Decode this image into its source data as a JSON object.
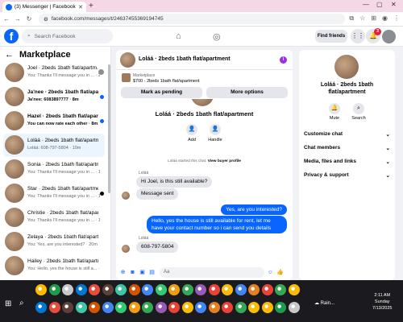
{
  "browser": {
    "tab_title": "(3) Messenger | Facebook",
    "new_tab_glyph": "+",
    "url": "facebook.com/messages/t/24637455369194745"
  },
  "header": {
    "search_placeholder": "Search Facebook",
    "find_friends": "Find friends",
    "notification_count": "3"
  },
  "marketplace": {
    "title": "Marketplace",
    "conversations": [
      {
        "name": "Joel · 2beds 1bath flat/apartm...",
        "preview": "You: Thanks I'll message you in ... · 2m",
        "unread": false,
        "mark": "mini"
      },
      {
        "name": "Ja'nee · 2beds 1bath flat/apart...",
        "preview": "Ja'nee: 6083897777 · 8m",
        "unread": true,
        "mark": "dot"
      },
      {
        "name": "Hazel · 2beds 1bath flat/apartm...",
        "preview": "You can now rate each other · 8m",
        "unread": true,
        "mark": "dot"
      },
      {
        "name": "Loláá · 2beds 1bath flat/apartm...",
        "preview": "Loláá: 608-797-5804 · 10m",
        "unread": false,
        "mark": "none"
      },
      {
        "name": "Sonia · 2beds 1bath flat/apartm...",
        "preview": "You: Thanks I'll message you in ... · 19m",
        "unread": false,
        "mark": "none"
      },
      {
        "name": "Star · 2beds 1bath flat/apartme...",
        "preview": "You: Thanks I'll message you in ... · 19m",
        "unread": false,
        "mark": "black"
      },
      {
        "name": "Christie · 2beds 1bath flat/apar...",
        "preview": "You: Thanks I'll message you in ... · 19m",
        "unread": false,
        "mark": "none"
      },
      {
        "name": "Zelaya · 2beds 1bath flat/apartm...",
        "preview": "You: Yes, are you interested? · 20m",
        "unread": false,
        "mark": "none"
      },
      {
        "name": "Hailey · 2beds 1bath flat/apartm...",
        "preview": "You: Hello, yes the house is still a... · 20m",
        "unread": false,
        "mark": "none"
      },
      {
        "name": "Dawn · 2beds 1bath flat/apartm...",
        "preview": "You: Yes, are you interested? · 20m",
        "unread": false,
        "mark": "none"
      }
    ]
  },
  "chat": {
    "title": "Loláá · 2beds 1bath flat/apartment",
    "listing_label": "Marketplace",
    "listing_detail": "$700 · 2beds 1bath flat/apartment",
    "mark_pending": "Mark as pending",
    "more_options": "More options",
    "profile_name": "Loláá · 2beds 1bath flat/apartment",
    "add_label": "Add",
    "handle_label": "Handle",
    "system_message": "Loláá started this chat.",
    "view_profile": "View buyer profile",
    "sender_name": "Loláá",
    "msg1": "Hi Joel, is this still available?",
    "msg2": "Message sent",
    "msg3": "Yes, are you interested?",
    "msg4": "Hello, yes the house is still available for rent, let me have your contact number so i can send you details",
    "sender_name2": "Loláá",
    "msg5": "608-797-5804",
    "input_placeholder": "Aa"
  },
  "details": {
    "name_line1": "Loláá · 2beds 1bath",
    "name_line2": "flat/apartment",
    "mute": "Mute",
    "search": "Search",
    "sections": [
      "Customize chat",
      "Chat members",
      "Media, files and links",
      "Privacy & support"
    ]
  },
  "taskbar": {
    "weather": "Rain...",
    "time": "2:11 AM",
    "day": "Sunday",
    "date": "7/13/2025"
  }
}
